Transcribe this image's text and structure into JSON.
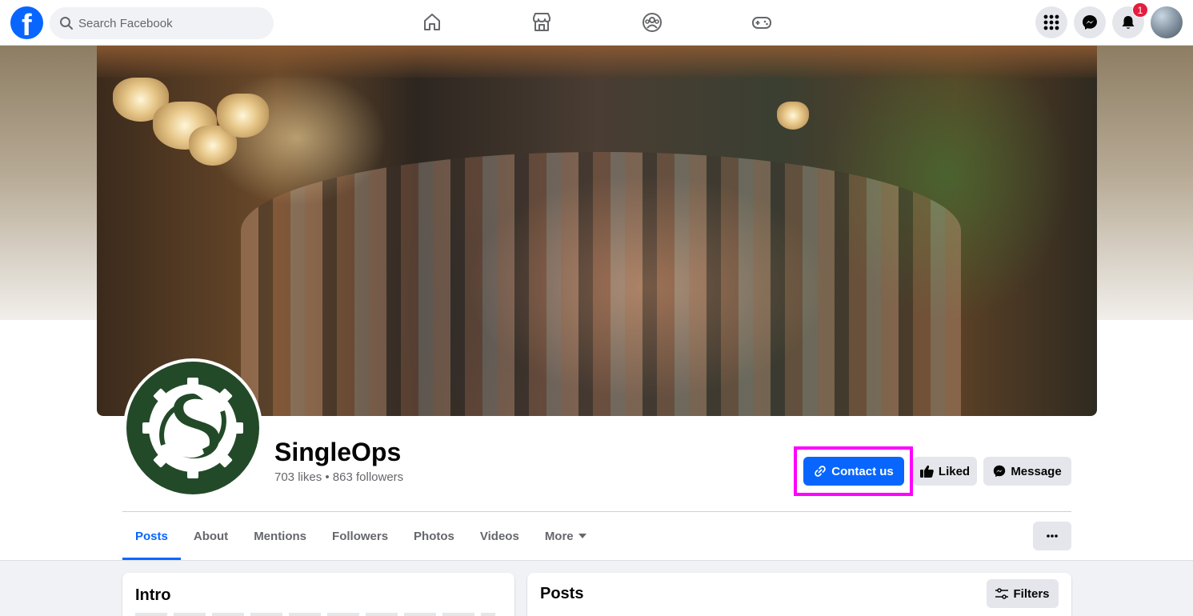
{
  "topnav": {
    "logo": "f",
    "search_placeholder": "Search Facebook",
    "icons": [
      "home-icon",
      "marketplace-icon",
      "groups-icon",
      "gaming-icon"
    ],
    "right_icons": [
      "menu-grid-icon",
      "messenger-icon",
      "notifications-icon"
    ],
    "notification_count": "1"
  },
  "page": {
    "name": "SingleOps",
    "stats": "703 likes • 863 followers",
    "brand_color": "#234a28"
  },
  "actions": {
    "contact": "Contact us",
    "liked": "Liked",
    "message": "Message"
  },
  "tabs": [
    "Posts",
    "About",
    "Mentions",
    "Followers",
    "Photos",
    "Videos",
    "More"
  ],
  "active_tab": "Posts",
  "intro": {
    "title": "Intro"
  },
  "posts": {
    "title": "Posts",
    "filters": "Filters"
  },
  "colors": {
    "accent": "#0866ff",
    "highlight": "#ff00ff",
    "badge": "#e41e3f"
  }
}
